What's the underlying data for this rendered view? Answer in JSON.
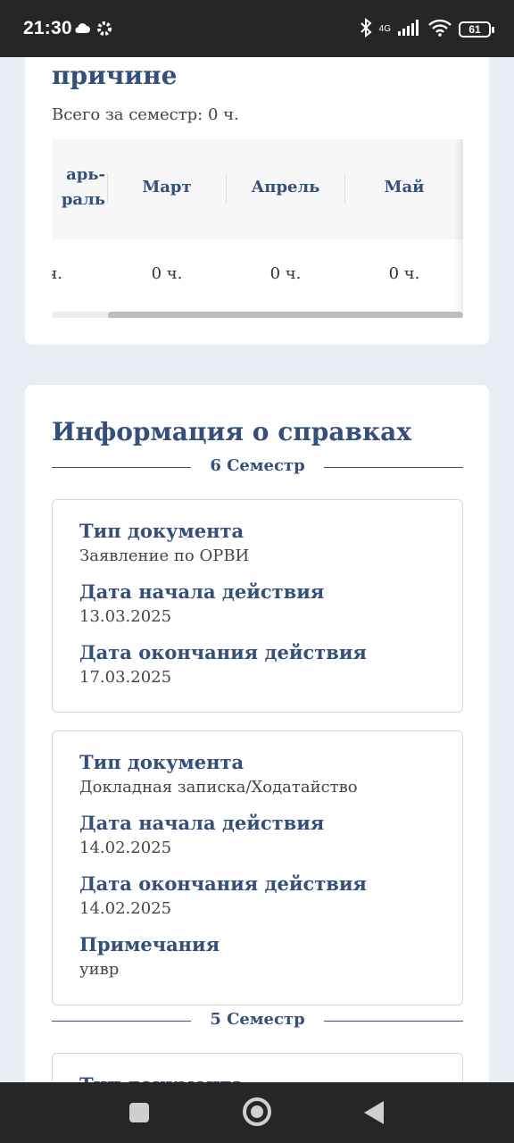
{
  "status_bar": {
    "time": "21:30",
    "network": "4G",
    "battery": "61"
  },
  "attendance_card": {
    "title": "причине",
    "total": "Всего за семестр: 0 ч.",
    "columns": [
      "арь-\nраль",
      "Март",
      "Апрель",
      "Май"
    ],
    "values": [
      "ч.",
      "0 ч.",
      "0 ч.",
      "0 ч."
    ]
  },
  "certificates": {
    "title": "Информация о справках",
    "semester6": "6 Семестр",
    "semester5": "5 Семестр",
    "doc1": {
      "type_label": "Тип документа",
      "type_value": "Заявление по ОРВИ",
      "start_label": "Дата начала действия",
      "start_value": "13.03.2025",
      "end_label": "Дата окончания действия",
      "end_value": "17.03.2025"
    },
    "doc2": {
      "type_label": "Тип документа",
      "type_value": "Докладная записка/Ходатайство",
      "start_label": "Дата начала действия",
      "start_value": "14.02.2025",
      "end_label": "Дата окончания действия",
      "end_value": "14.02.2025",
      "notes_label": "Примечания",
      "notes_value": "уивр"
    },
    "doc3": {
      "type_label": "Тип документа"
    }
  }
}
